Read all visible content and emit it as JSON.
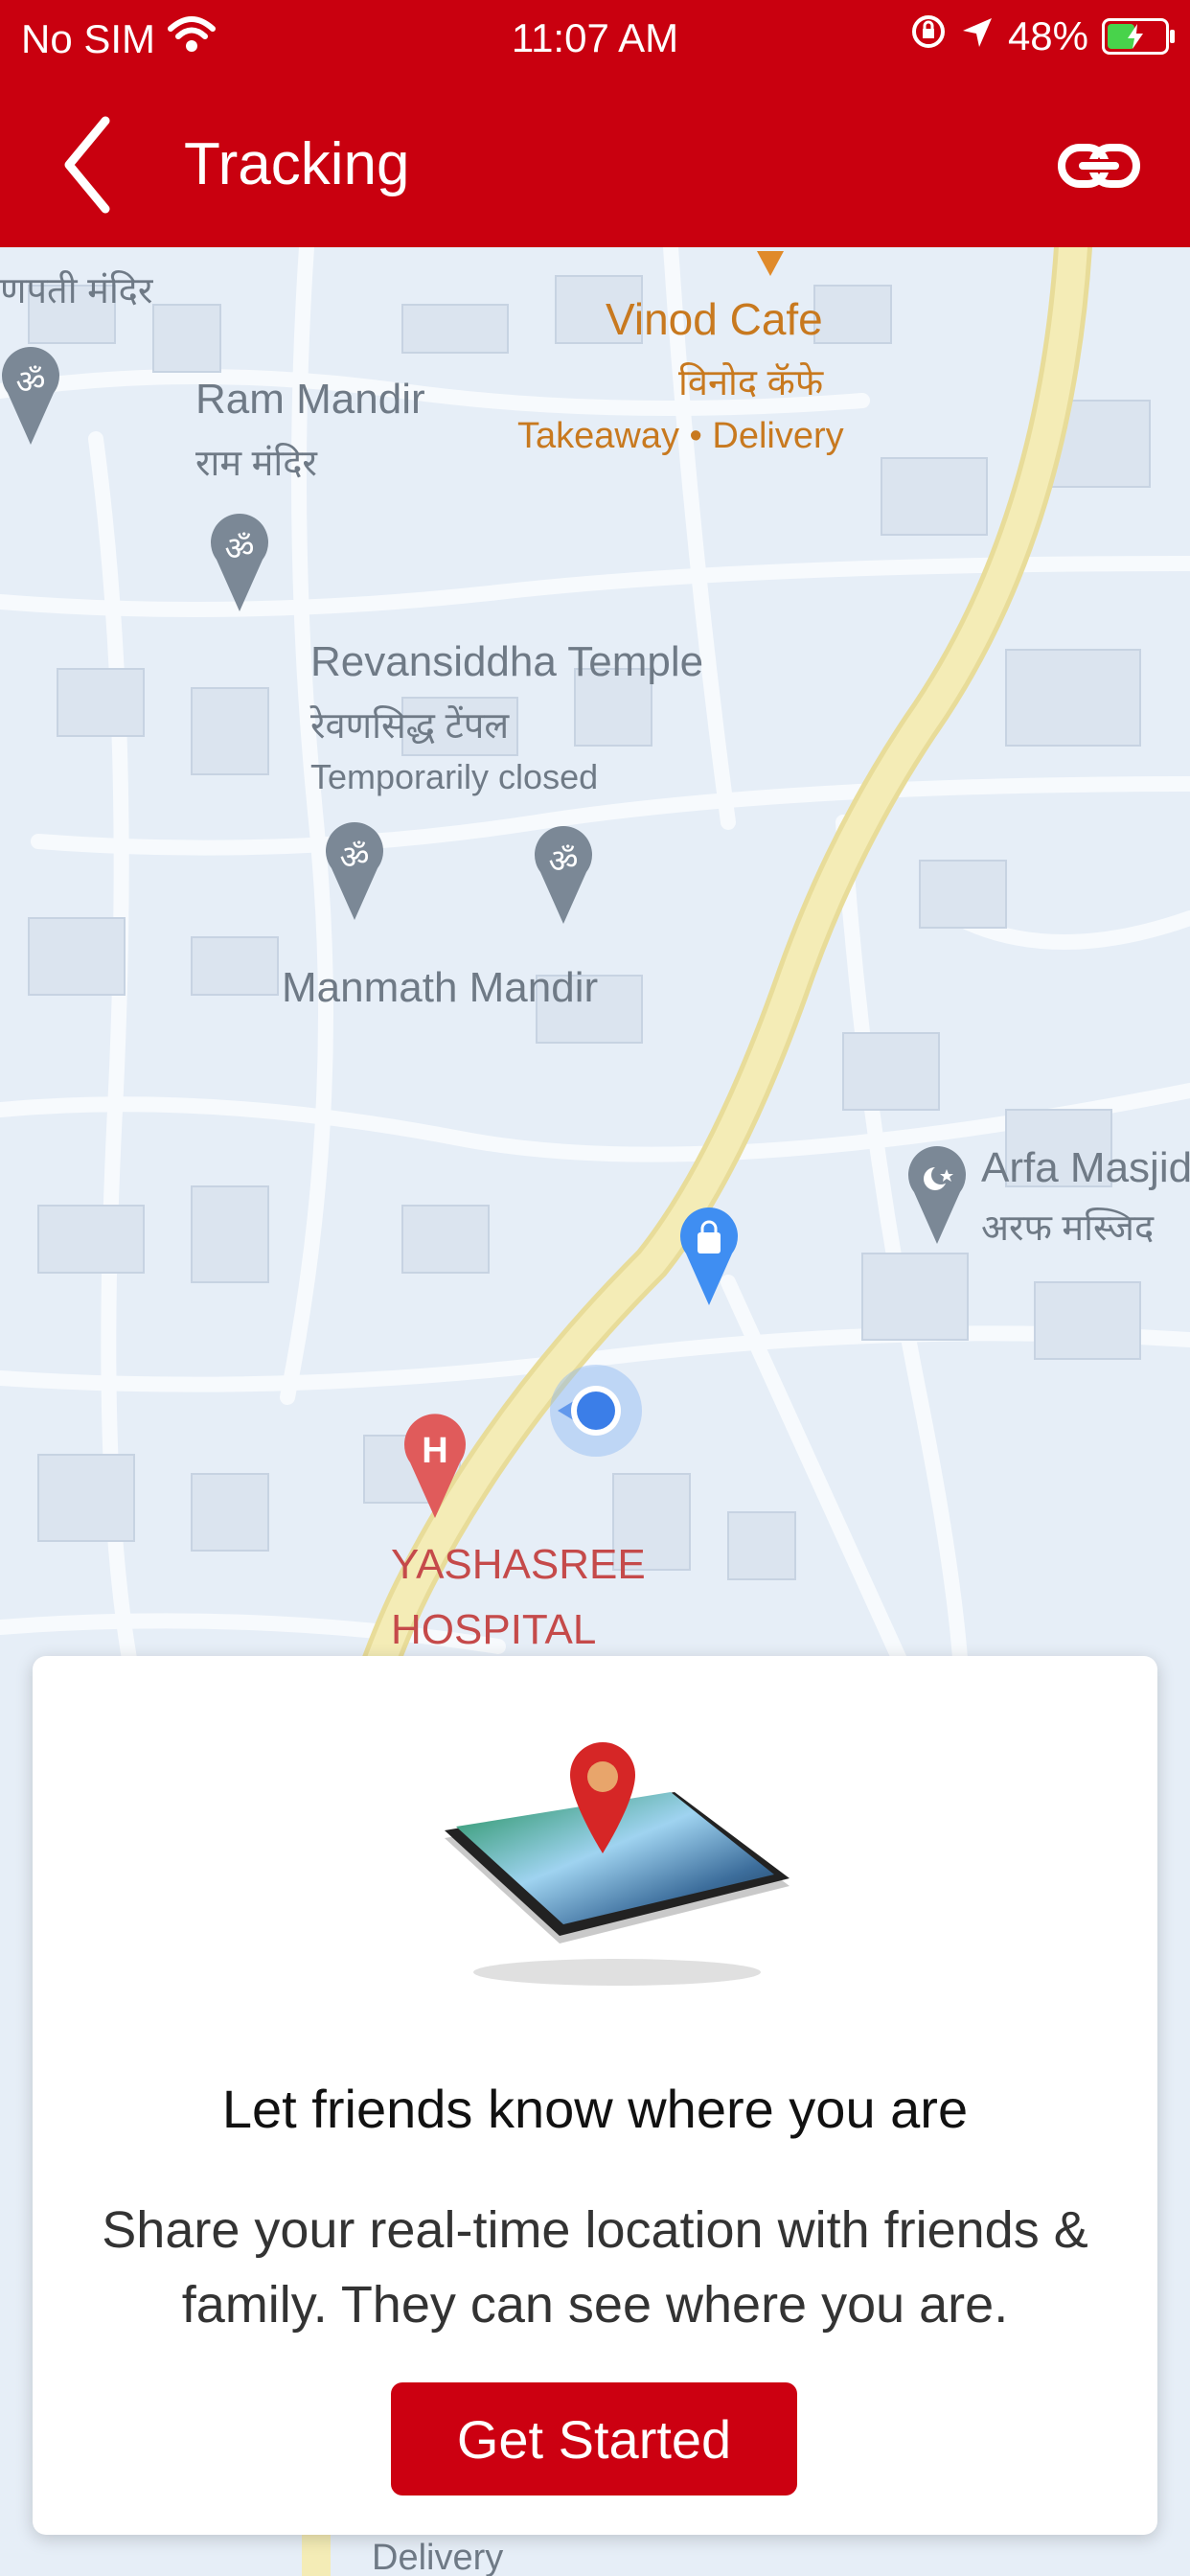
{
  "status_bar": {
    "carrier": "No SIM",
    "time": "11:07 AM",
    "battery_percent": "48%",
    "icons": [
      "wifi-icon",
      "rotation-lock-icon",
      "location-arrow-icon",
      "battery-charging-icon"
    ]
  },
  "header": {
    "title": "Tracking",
    "back_icon": "chevron-left-icon",
    "action_icon": "link-icon",
    "background": "#c9000f"
  },
  "map": {
    "labels": {
      "ganpati_mandir_hi": "णपती मंदिर",
      "vinod_cafe": "Vinod Cafe",
      "vinod_cafe_hi": "विनोद कॅफे",
      "vinod_cafe_services": "Takeaway • Delivery",
      "ram_mandir": "Ram Mandir",
      "ram_mandir_hi": "राम मंदिर",
      "revansiddha": "Revansiddha Temple",
      "revansiddha_hi": "रेवणसिद्ध टेंपल",
      "revansiddha_status": "Temporarily closed",
      "manmath_mandir": "Manmath Mandir",
      "arfa_masjid": "Arfa Masjid",
      "arfa_masjid_hi": "अरफ मस्जिद",
      "hospital_line1": "YASHASREE",
      "hospital_line2": "HOSPITAL",
      "bottom_delivery": "Delivery"
    }
  },
  "card": {
    "title": "Let friends know where you are",
    "description": "Share your real-time location with friends & family. They can see where you are.",
    "button_label": "Get Started",
    "illustration": "phone-location-pin-illustration"
  },
  "colors": {
    "brand_red": "#c9000f",
    "button_red": "#cc0011",
    "map_bg": "#e6eef7",
    "main_road": "#f1e7a8"
  }
}
